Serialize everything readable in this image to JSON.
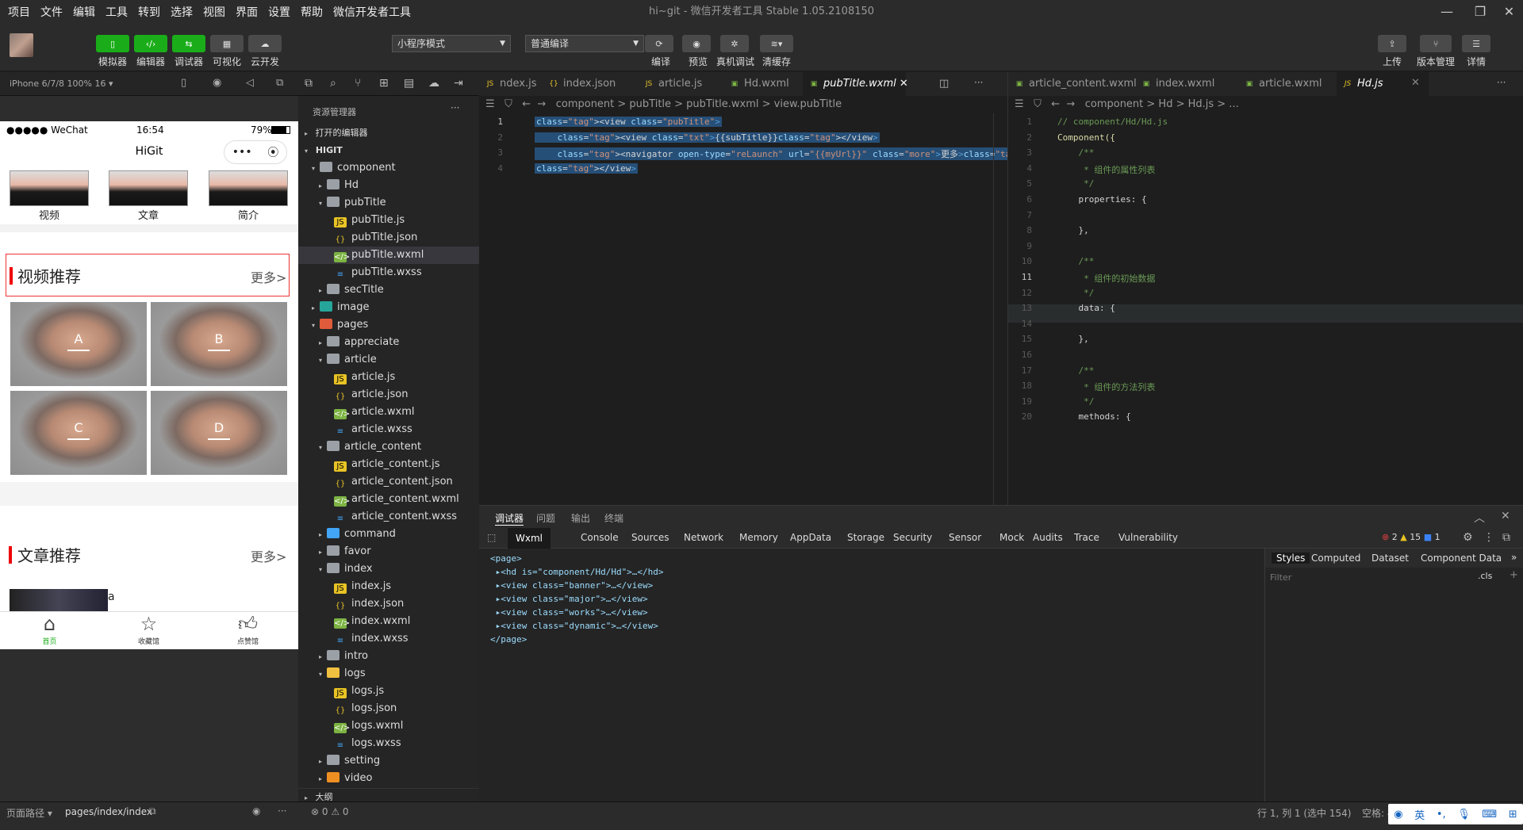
{
  "menu": [
    "项目",
    "文件",
    "编辑",
    "工具",
    "转到",
    "选择",
    "视图",
    "界面",
    "设置",
    "帮助",
    "微信开发者工具"
  ],
  "window_title": "hi~git - 微信开发者工具 Stable 1.05.2108150",
  "toolbar": {
    "left_buttons": [
      {
        "label": "模拟器",
        "icon": "phone-icon"
      },
      {
        "label": "编辑器",
        "icon": "code-icon"
      },
      {
        "label": "调试器",
        "icon": "debug-icon"
      },
      {
        "label": "可视化",
        "icon": "layout-icon"
      },
      {
        "label": "云开发",
        "icon": "cloud-icon"
      }
    ],
    "mode_select": "小程序模式",
    "compile_select": "普通编译",
    "mid_buttons": [
      "编译",
      "预览",
      "真机调试",
      "清缓存"
    ],
    "right_buttons": [
      "上传",
      "版本管理",
      "详情"
    ]
  },
  "simulator": {
    "device": "iPhone 6/7/8 100% 16 ▾",
    "status_left": "●●●●● WeChat",
    "status_time": "16:54",
    "status_battery": "79%",
    "nav_title": "HiGit",
    "banner": [
      "视频",
      "文章",
      "简介"
    ],
    "video_section": {
      "title": "视频推荐",
      "more": "更多>"
    },
    "videos": [
      "A",
      "B",
      "C",
      "D"
    ],
    "article_section": {
      "title": "文章推荐",
      "more": "更多>"
    },
    "article_first_letter": "a",
    "tabs": [
      "首页",
      "收藏馆",
      "点赞馆"
    ]
  },
  "explorer": {
    "title": "资源管理器",
    "open_editors": "打开的编辑器",
    "project": "HIGIT",
    "outline": "大纲",
    "rows": [
      {
        "label": "component",
        "depth": 1,
        "type": "ofolder",
        "arrow": "▾"
      },
      {
        "label": "Hd",
        "depth": 2,
        "type": "folder",
        "arrow": "▸"
      },
      {
        "label": "pubTitle",
        "depth": 2,
        "type": "ofolder",
        "arrow": "▾"
      },
      {
        "label": "pubTitle.js",
        "depth": 3,
        "type": "js"
      },
      {
        "label": "pubTitle.json",
        "depth": 3,
        "type": "json"
      },
      {
        "label": "pubTitle.wxml",
        "depth": 3,
        "type": "wxml",
        "selected": true
      },
      {
        "label": "pubTitle.wxss",
        "depth": 3,
        "type": "wxss"
      },
      {
        "label": "secTitle",
        "depth": 2,
        "type": "folder",
        "arrow": "▸"
      },
      {
        "label": "image",
        "depth": 1,
        "type": "img",
        "arrow": "▸"
      },
      {
        "label": "pages",
        "depth": 1,
        "type": "pages",
        "arrow": "▾"
      },
      {
        "label": "appreciate",
        "depth": 2,
        "type": "folder",
        "arrow": "▸"
      },
      {
        "label": "article",
        "depth": 2,
        "type": "ofolder",
        "arrow": "▾"
      },
      {
        "label": "article.js",
        "depth": 3,
        "type": "js"
      },
      {
        "label": "article.json",
        "depth": 3,
        "type": "json"
      },
      {
        "label": "article.wxml",
        "depth": 3,
        "type": "wxml"
      },
      {
        "label": "article.wxss",
        "depth": 3,
        "type": "wxss"
      },
      {
        "label": "article_content",
        "depth": 2,
        "type": "ofolder",
        "arrow": "▾"
      },
      {
        "label": "article_content.js",
        "depth": 3,
        "type": "js"
      },
      {
        "label": "article_content.json",
        "depth": 3,
        "type": "json"
      },
      {
        "label": "article_content.wxml",
        "depth": 3,
        "type": "wxml"
      },
      {
        "label": "article_content.wxss",
        "depth": 3,
        "type": "wxss"
      },
      {
        "label": "command",
        "depth": 2,
        "type": "cmd",
        "arrow": "▸"
      },
      {
        "label": "favor",
        "depth": 2,
        "type": "folder",
        "arrow": "▸"
      },
      {
        "label": "index",
        "depth": 2,
        "type": "ofolder",
        "arrow": "▾"
      },
      {
        "label": "index.js",
        "depth": 3,
        "type": "js"
      },
      {
        "label": "index.json",
        "depth": 3,
        "type": "json"
      },
      {
        "label": "index.wxml",
        "depth": 3,
        "type": "wxml"
      },
      {
        "label": "index.wxss",
        "depth": 3,
        "type": "wxss"
      },
      {
        "label": "intro",
        "depth": 2,
        "type": "folder",
        "arrow": "▸"
      },
      {
        "label": "logs",
        "depth": 2,
        "type": "logs",
        "arrow": "▾"
      },
      {
        "label": "logs.js",
        "depth": 3,
        "type": "js"
      },
      {
        "label": "logs.json",
        "depth": 3,
        "type": "json"
      },
      {
        "label": "logs.wxml",
        "depth": 3,
        "type": "wxml"
      },
      {
        "label": "logs.wxss",
        "depth": 3,
        "type": "wxss"
      },
      {
        "label": "setting",
        "depth": 2,
        "type": "folder",
        "arrow": "▸"
      },
      {
        "label": "video",
        "depth": 2,
        "type": "video",
        "arrow": "▸"
      }
    ]
  },
  "editor1": {
    "tabs": [
      {
        "label": "ndex.js",
        "type": "js"
      },
      {
        "label": "index.json",
        "type": "json"
      },
      {
        "label": "article.js",
        "type": "js"
      },
      {
        "label": "Hd.wxml",
        "type": "wxml"
      },
      {
        "label": "pubTitle.wxml",
        "type": "wxml",
        "active": true
      }
    ],
    "breadcrumb": "component > pubTitle > pubTitle.wxml > view.pubTitle",
    "lines": [
      {
        "n": "1",
        "code": "<view class=\"pubTitle\">"
      },
      {
        "n": "2",
        "code": "    <view class=\"txt\">{{subTitle}}</view>"
      },
      {
        "n": "3",
        "code": "    <navigator open-type=\"reLaunch\" url=\"{{myUrl}}\" class=\"more\">更多></navigator>"
      },
      {
        "n": "4",
        "code": "</view>"
      }
    ]
  },
  "editor2": {
    "tabs": [
      {
        "label": "article_content.wxml",
        "type": "wxml"
      },
      {
        "label": "index.wxml",
        "type": "wxml"
      },
      {
        "label": "article.wxml",
        "type": "wxml"
      },
      {
        "label": "Hd.js",
        "type": "js",
        "active": true
      }
    ],
    "breadcrumb": "component > Hd > Hd.js > ...",
    "lines": [
      {
        "n": "1",
        "code": "// component/Hd/Hd.js",
        "cls": "cm"
      },
      {
        "n": "2",
        "code": "Component({",
        "cls": "kw"
      },
      {
        "n": "3",
        "code": "    /**",
        "cls": "cm"
      },
      {
        "n": "4",
        "code": "     * 组件的属性列表",
        "cls": "cm"
      },
      {
        "n": "5",
        "code": "     */",
        "cls": "cm"
      },
      {
        "n": "6",
        "code": "    properties: {",
        "cls": "plain"
      },
      {
        "n": "7",
        "code": "",
        "cls": "plain"
      },
      {
        "n": "8",
        "code": "    },",
        "cls": "plain"
      },
      {
        "n": "9",
        "code": "",
        "cls": "plain"
      },
      {
        "n": "10",
        "code": "    /**",
        "cls": "cm"
      },
      {
        "n": "11",
        "code": "     * 组件的初始数据",
        "cls": "cm"
      },
      {
        "n": "12",
        "code": "     */",
        "cls": "cm"
      },
      {
        "n": "13",
        "code": "    data: {",
        "cls": "plain"
      },
      {
        "n": "14",
        "code": "",
        "cls": "plain"
      },
      {
        "n": "15",
        "code": "    },",
        "cls": "plain"
      },
      {
        "n": "16",
        "code": "",
        "cls": "plain"
      },
      {
        "n": "17",
        "code": "    /**",
        "cls": "cm"
      },
      {
        "n": "18",
        "code": "     * 组件的方法列表",
        "cls": "cm"
      },
      {
        "n": "19",
        "code": "     */",
        "cls": "cm"
      },
      {
        "n": "20",
        "code": "    methods: {",
        "cls": "plain"
      }
    ]
  },
  "devtools": {
    "top_tabs": [
      "调试器",
      "问题",
      "输出",
      "终端"
    ],
    "tabs": [
      "Wxml",
      "Console",
      "Sources",
      "Network",
      "Memory",
      "AppData",
      "Storage",
      "Security",
      "Sensor",
      "Mock",
      "Audits",
      "Trace",
      "Vulnerability"
    ],
    "errors": "2",
    "warnings": "15",
    "infos": "1",
    "xml": [
      "<page>",
      " ▸<hd is=\"component/Hd/Hd\">…</hd>",
      " ▸<view class=\"banner\">…</view>",
      " ▸<view class=\"major\">…</view>",
      " ▸<view class=\"works\">…</view>",
      " ▸<view class=\"dynamic\">…</view>",
      "</page>"
    ],
    "side_tabs": [
      "Styles",
      "Computed",
      "Dataset",
      "Component Data"
    ],
    "filter_placeholder": "Filter",
    "cls": ".cls"
  },
  "statusbar": {
    "path_label": "页面路径 ▾",
    "path": "pages/index/index",
    "problems": "⊗ 0 ⚠ 0",
    "cursor": "行 1, 列 1 (选中 154)",
    "indent": "空格: 4",
    "ime": "英"
  }
}
